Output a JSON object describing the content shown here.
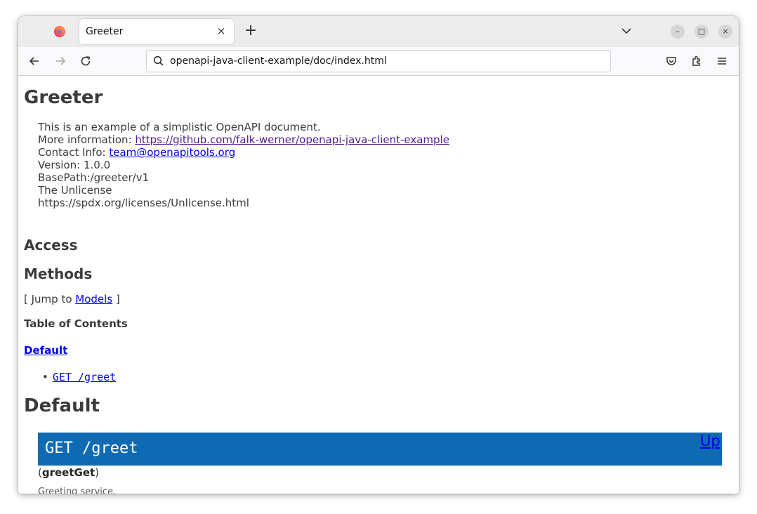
{
  "browser": {
    "tab_title": "Greeter",
    "tab_close": "×",
    "new_tab": "+",
    "url": "openapi-java-client-example/doc/index.html",
    "window_buttons": {
      "minimize": "–",
      "maximize": "□",
      "close": "×"
    }
  },
  "page": {
    "title": "Greeter",
    "info": {
      "description": "This is an example of a simplistic OpenAPI document.",
      "more_info_label": "More information: ",
      "more_info_link": "https://github.com/falk-werner/openapi-java-client-example",
      "contact_label": "Contact Info: ",
      "contact_link": "team@openapitools.org",
      "version": "Version: 1.0.0",
      "basepath": "BasePath:/greeter/v1",
      "license_name": "The Unlicense",
      "license_url": "https://spdx.org/licenses/Unlicense.html"
    },
    "access_heading": "Access",
    "methods_heading": "Methods",
    "jump_prefix": "[ Jump to ",
    "jump_link": "Models",
    "jump_suffix": " ]",
    "toc_heading": "Table of Contents",
    "toc_group": "Default",
    "toc_item": "GET /greet",
    "section_heading": "Default",
    "method": {
      "header": "GET /greet",
      "up_link": "Up",
      "nickname_open": "(",
      "nickname": "greetGet",
      "nickname_close": ")",
      "summary": "Greeting service."
    }
  },
  "colors": {
    "method_bar": "#0f6ab4",
    "link": "#0000ee",
    "visited_link": "#551a8b"
  }
}
